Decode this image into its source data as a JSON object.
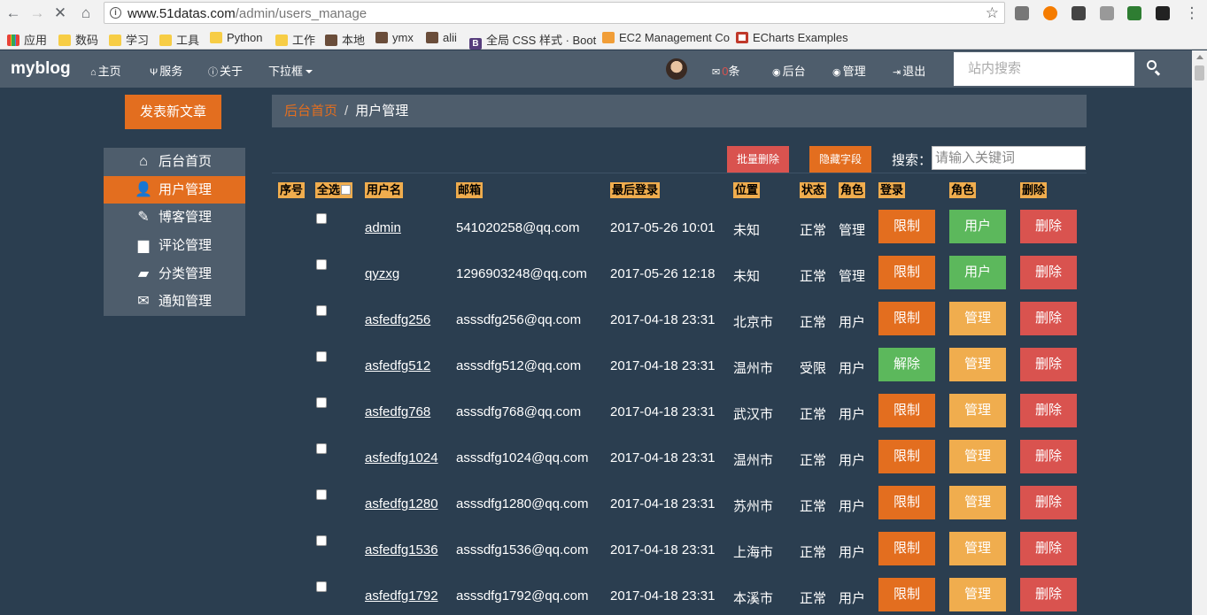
{
  "browser": {
    "url_host": "www.51datas.com",
    "url_path": "/admin/users_manage",
    "bookmarks": [
      "应用",
      "数码",
      "学习",
      "工具",
      "Python",
      "工作",
      "本地",
      "ymx",
      "alii",
      "全局 CSS 样式 · Boot",
      "EC2 Management Co",
      "ECharts Examples"
    ]
  },
  "navbar": {
    "brand": "myblog",
    "items": [
      "主页",
      "服务",
      "关于",
      "下拉框"
    ],
    "message_count": "0",
    "message_unit": "条",
    "right_items": [
      "后台",
      "管理",
      "退出"
    ],
    "search_placeholder": "站内搜索"
  },
  "sidebar": {
    "new_post": "发表新文章",
    "items": [
      {
        "label": "后台首页",
        "icon": "home-icon",
        "glyph": "⌂"
      },
      {
        "label": "用户管理",
        "icon": "user-icon",
        "glyph": "👤"
      },
      {
        "label": "博客管理",
        "icon": "pencil-icon",
        "glyph": "✎"
      },
      {
        "label": "评论管理",
        "icon": "comment-icon",
        "glyph": "▆"
      },
      {
        "label": "分类管理",
        "icon": "folder-open-icon",
        "glyph": "▰"
      },
      {
        "label": "通知管理",
        "icon": "envelope-icon",
        "glyph": "✉"
      }
    ]
  },
  "breadcrumb": {
    "home": "后台首页",
    "sep": "/",
    "current": "用户管理"
  },
  "tools": {
    "bulk_delete": "批量删除",
    "hide_fields": "隐藏字段",
    "search_label": "搜索：",
    "search_placeholder": "请输入关键词"
  },
  "table": {
    "headers": [
      "序号",
      "全选",
      "用户名",
      "邮箱",
      "最后登录",
      "位置",
      "状态",
      "角色",
      "登录",
      "角色",
      "删除"
    ],
    "rows": [
      {
        "user": "admin",
        "email": "541020258@qq.com",
        "login": "2017-05-26 10:01",
        "loc": "未知",
        "status": "正常",
        "role": "管理",
        "b1": "限制",
        "b2": "用户",
        "b3": "删除"
      },
      {
        "user": "qyzxg",
        "email": "1296903248@qq.com",
        "login": "2017-05-26 12:18",
        "loc": "未知",
        "status": "正常",
        "role": "管理",
        "b1": "限制",
        "b2": "用户",
        "b3": "删除"
      },
      {
        "user": "asfedfg256",
        "email": "asssdfg256@qq.com",
        "login": "2017-04-18 23:31",
        "loc": "北京市",
        "status": "正常",
        "role": "用户",
        "b1": "限制",
        "b2": "管理",
        "b3": "删除"
      },
      {
        "user": "asfedfg512",
        "email": "asssdfg512@qq.com",
        "login": "2017-04-18 23:31",
        "loc": "温州市",
        "status": "受限",
        "role": "用户",
        "b1": "解除",
        "b2": "管理",
        "b3": "删除"
      },
      {
        "user": "asfedfg768",
        "email": "asssdfg768@qq.com",
        "login": "2017-04-18 23:31",
        "loc": "武汉市",
        "status": "正常",
        "role": "用户",
        "b1": "限制",
        "b2": "管理",
        "b3": "删除"
      },
      {
        "user": "asfedfg1024",
        "email": "asssdfg1024@qq.com",
        "login": "2017-04-18 23:31",
        "loc": "温州市",
        "status": "正常",
        "role": "用户",
        "b1": "限制",
        "b2": "管理",
        "b3": "删除"
      },
      {
        "user": "asfedfg1280",
        "email": "asssdfg1280@qq.com",
        "login": "2017-04-18 23:31",
        "loc": "苏州市",
        "status": "正常",
        "role": "用户",
        "b1": "限制",
        "b2": "管理",
        "b3": "删除"
      },
      {
        "user": "asfedfg1536",
        "email": "asssdfg1536@qq.com",
        "login": "2017-04-18 23:31",
        "loc": "上海市",
        "status": "正常",
        "role": "用户",
        "b1": "限制",
        "b2": "管理",
        "b3": "删除"
      },
      {
        "user": "asfedfg1792",
        "email": "asssdfg1792@qq.com",
        "login": "2017-04-18 23:31",
        "loc": "本溪市",
        "status": "正常",
        "role": "用户",
        "b1": "限制",
        "b2": "管理",
        "b3": "删除"
      }
    ]
  },
  "colors": {
    "page_bg": "#2b3e50",
    "panel": "#4e5d6c",
    "orange": "#e36e1f",
    "green": "#5cb85c",
    "yellow": "#f0ad4e",
    "red": "#d9534f"
  }
}
